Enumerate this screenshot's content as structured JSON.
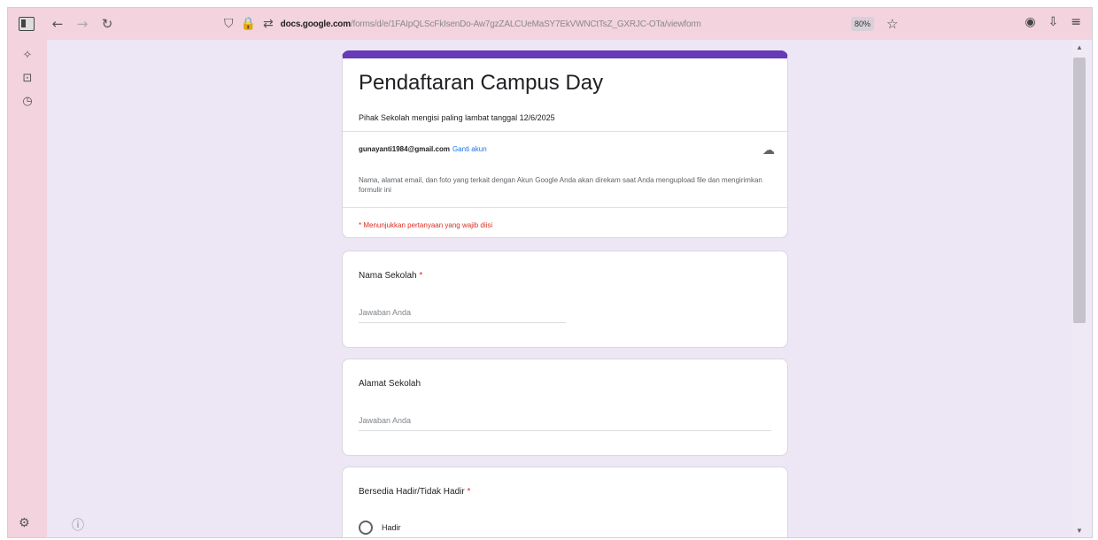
{
  "browser": {
    "url_host": "docs.google.com",
    "url_path": "/forms/d/e/1FAIpQLScFkIsenDo-Aw7gzZALCUeMaSY7EkVWNCtTsZ_GXRJC-OTa/viewform",
    "zoom": "80%",
    "icons": {
      "sidebar": "sidebar-icon",
      "back": "back-arrow-icon",
      "forward": "forward-arrow-icon",
      "reload": "reload-icon",
      "shield": "shield-icon",
      "lock": "lock-icon",
      "permissions": "permissions-icon",
      "star": "star-icon"
    }
  },
  "form": {
    "accent": "#673ab7",
    "title": "Pendaftaran Campus Day",
    "description": "Pihak Sekolah mengisi paling lambat tanggal 12/6/2025",
    "account_email": "gunayanti1984@gmail.com",
    "switch_account": "Ganti akun",
    "notice": "Nama, alamat email, dan foto yang terkait dengan Akun Google Anda akan direkam saat Anda mengupload file dan mengirimkan formulir ini",
    "required_note": "* Menunjukkan pertanyaan yang wajib diisi",
    "questions": [
      {
        "label": "Nama Sekolah",
        "required": "*",
        "placeholder": "Jawaban Anda"
      },
      {
        "label": "Alamat Sekolah",
        "placeholder": "Jawaban Anda"
      },
      {
        "label": "Bersedia Hadir/Tidak Hadir",
        "required": "*",
        "options": [
          "Hadir"
        ]
      }
    ]
  }
}
